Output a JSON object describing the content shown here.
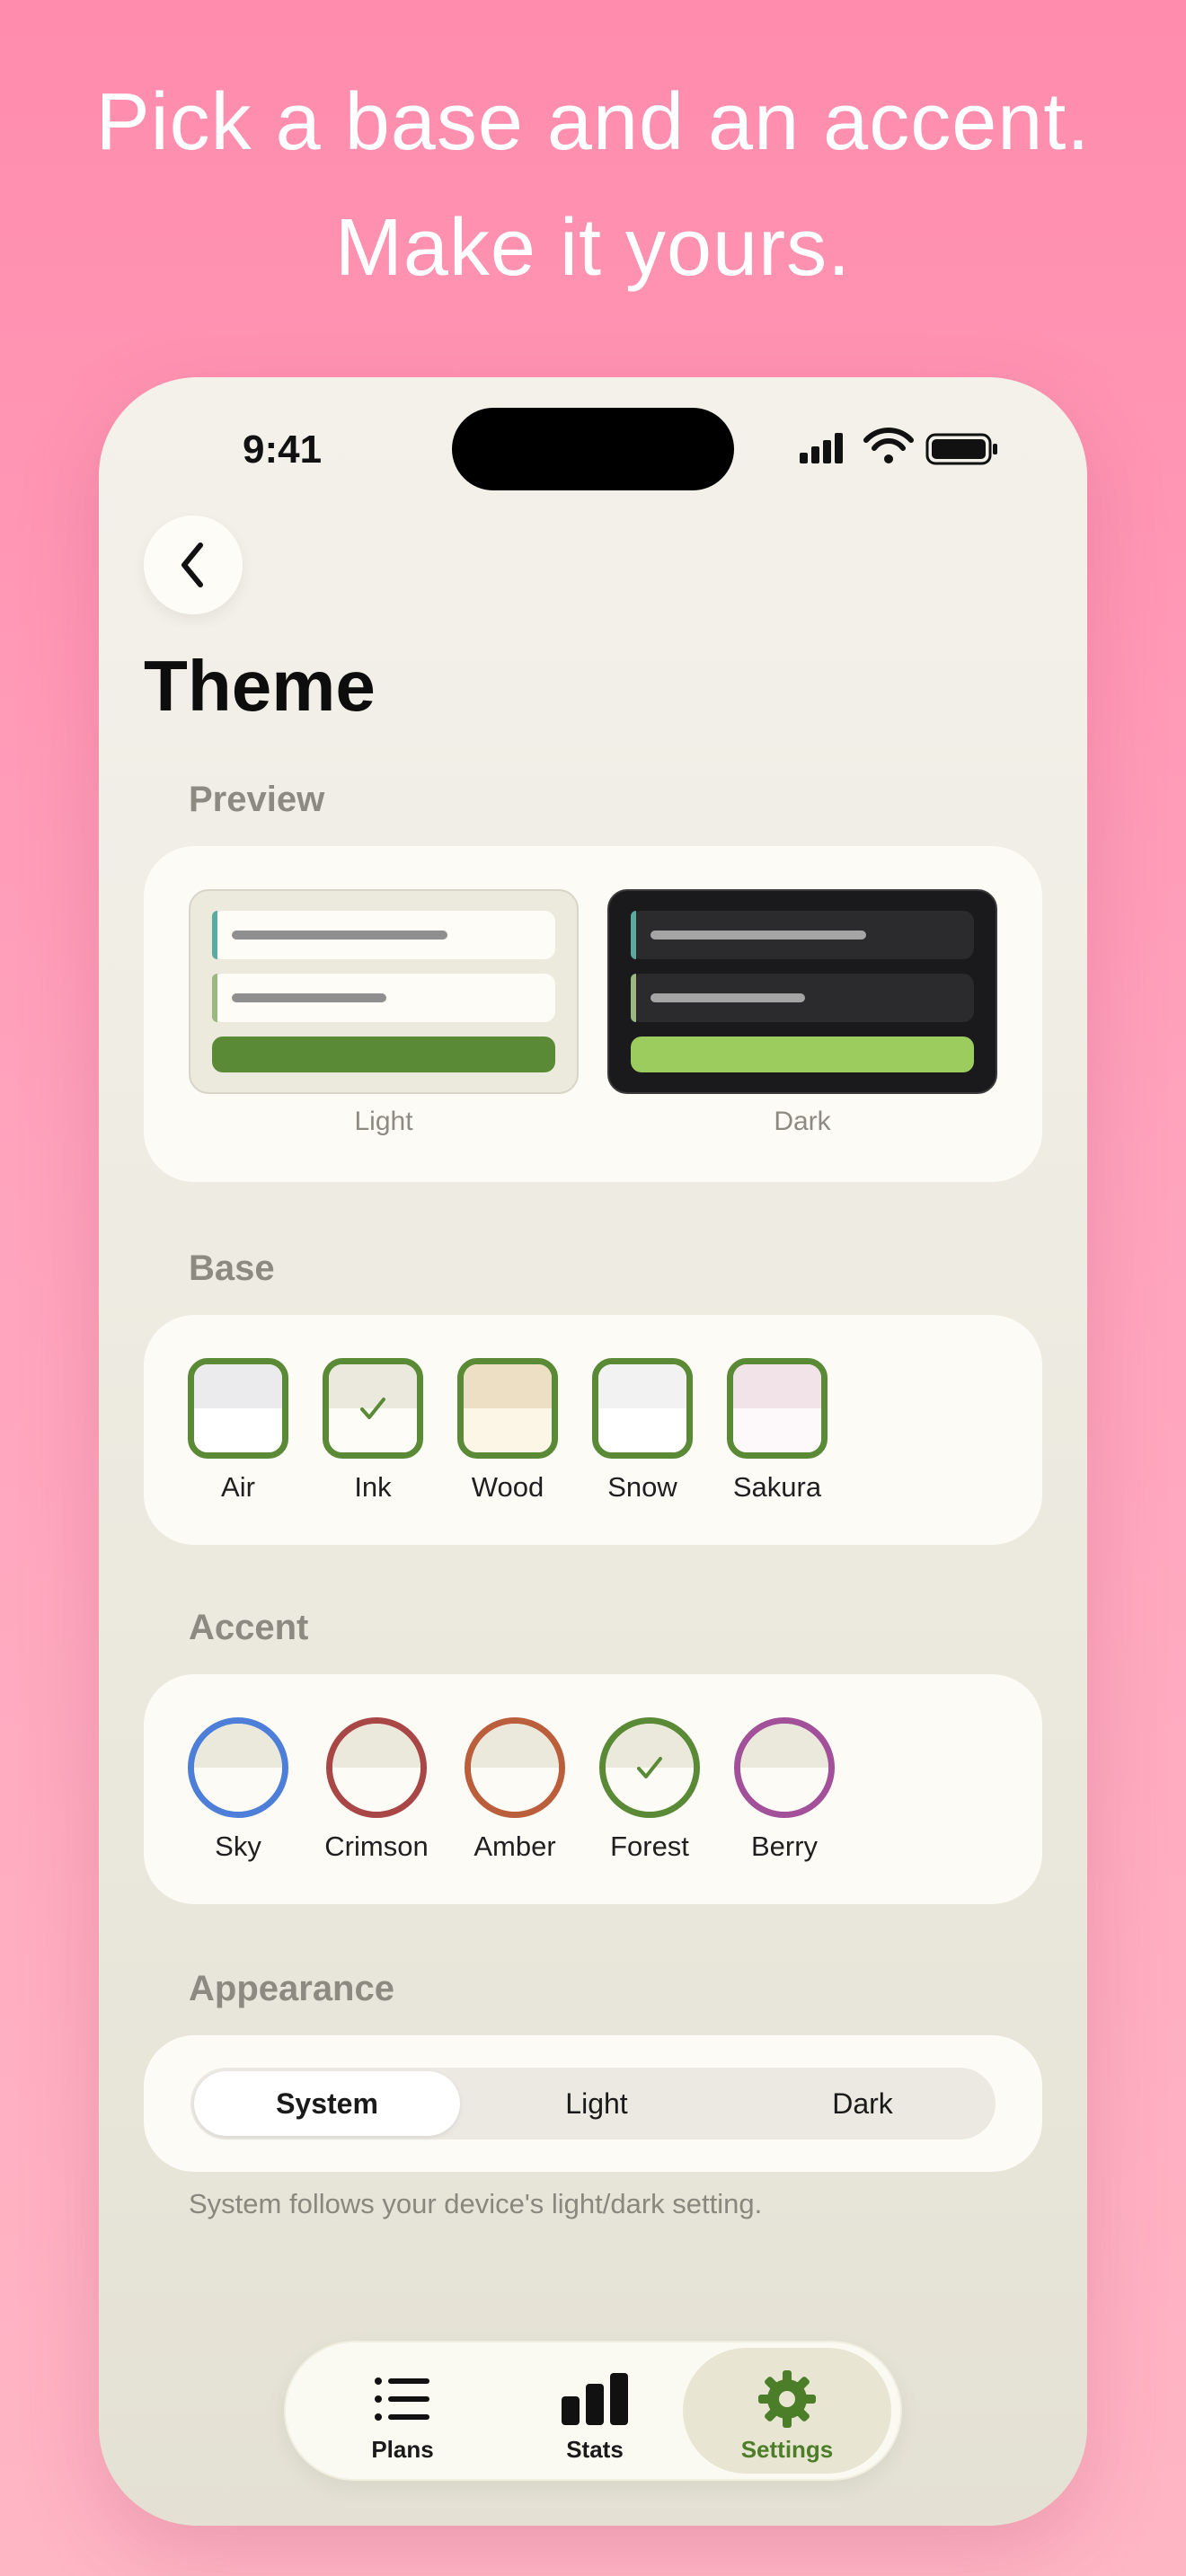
{
  "headline": {
    "line1": "Pick a base and an accent.",
    "line2": "Make it yours."
  },
  "status_bar": {
    "time": "9:41"
  },
  "page": {
    "title": "Theme"
  },
  "sections": {
    "preview": "Preview",
    "base": "Base",
    "accent": "Accent",
    "appearance": "Appearance"
  },
  "preview": {
    "light_label": "Light",
    "dark_label": "Dark"
  },
  "base_options": [
    {
      "label": "Air",
      "selected": false,
      "top_color": "#ebebed",
      "bottom_color": "#ffffff"
    },
    {
      "label": "Ink",
      "selected": true,
      "top_color": "#ebe9dd",
      "bottom_color": "#fdfcf7"
    },
    {
      "label": "Wood",
      "selected": false,
      "top_color": "#ecdfc3",
      "bottom_color": "#fcf6e7"
    },
    {
      "label": "Snow",
      "selected": false,
      "top_color": "#f2f2f2",
      "bottom_color": "#ffffff"
    },
    {
      "label": "Sakura",
      "selected": false,
      "top_color": "#f2e3e8",
      "bottom_color": "#fdf8f9"
    }
  ],
  "accent_options": [
    {
      "label": "Sky",
      "selected": false,
      "color": "#4d7fd9"
    },
    {
      "label": "Crimson",
      "selected": false,
      "color": "#a94646"
    },
    {
      "label": "Amber",
      "selected": false,
      "color": "#bb5e3c"
    },
    {
      "label": "Forest",
      "selected": true,
      "color": "#5a8a36"
    },
    {
      "label": "Berry",
      "selected": false,
      "color": "#a2509a"
    }
  ],
  "appearance": {
    "options": [
      "System",
      "Light",
      "Dark"
    ],
    "selected": "System",
    "help_text": "System follows your device's light/dark setting."
  },
  "tabbar": {
    "items": [
      {
        "label": "Plans",
        "icon": "list-icon"
      },
      {
        "label": "Stats",
        "icon": "bar-chart-icon"
      },
      {
        "label": "Settings",
        "icon": "gear-icon"
      }
    ],
    "active": "Settings"
  },
  "colors": {
    "accent": "#5a8a36",
    "preview_light_button": "#5a8a36",
    "preview_dark_button": "#9ccb5e",
    "preview_stripe_teal": "#5aaaa0",
    "preview_stripe_green": "#9bb880"
  }
}
